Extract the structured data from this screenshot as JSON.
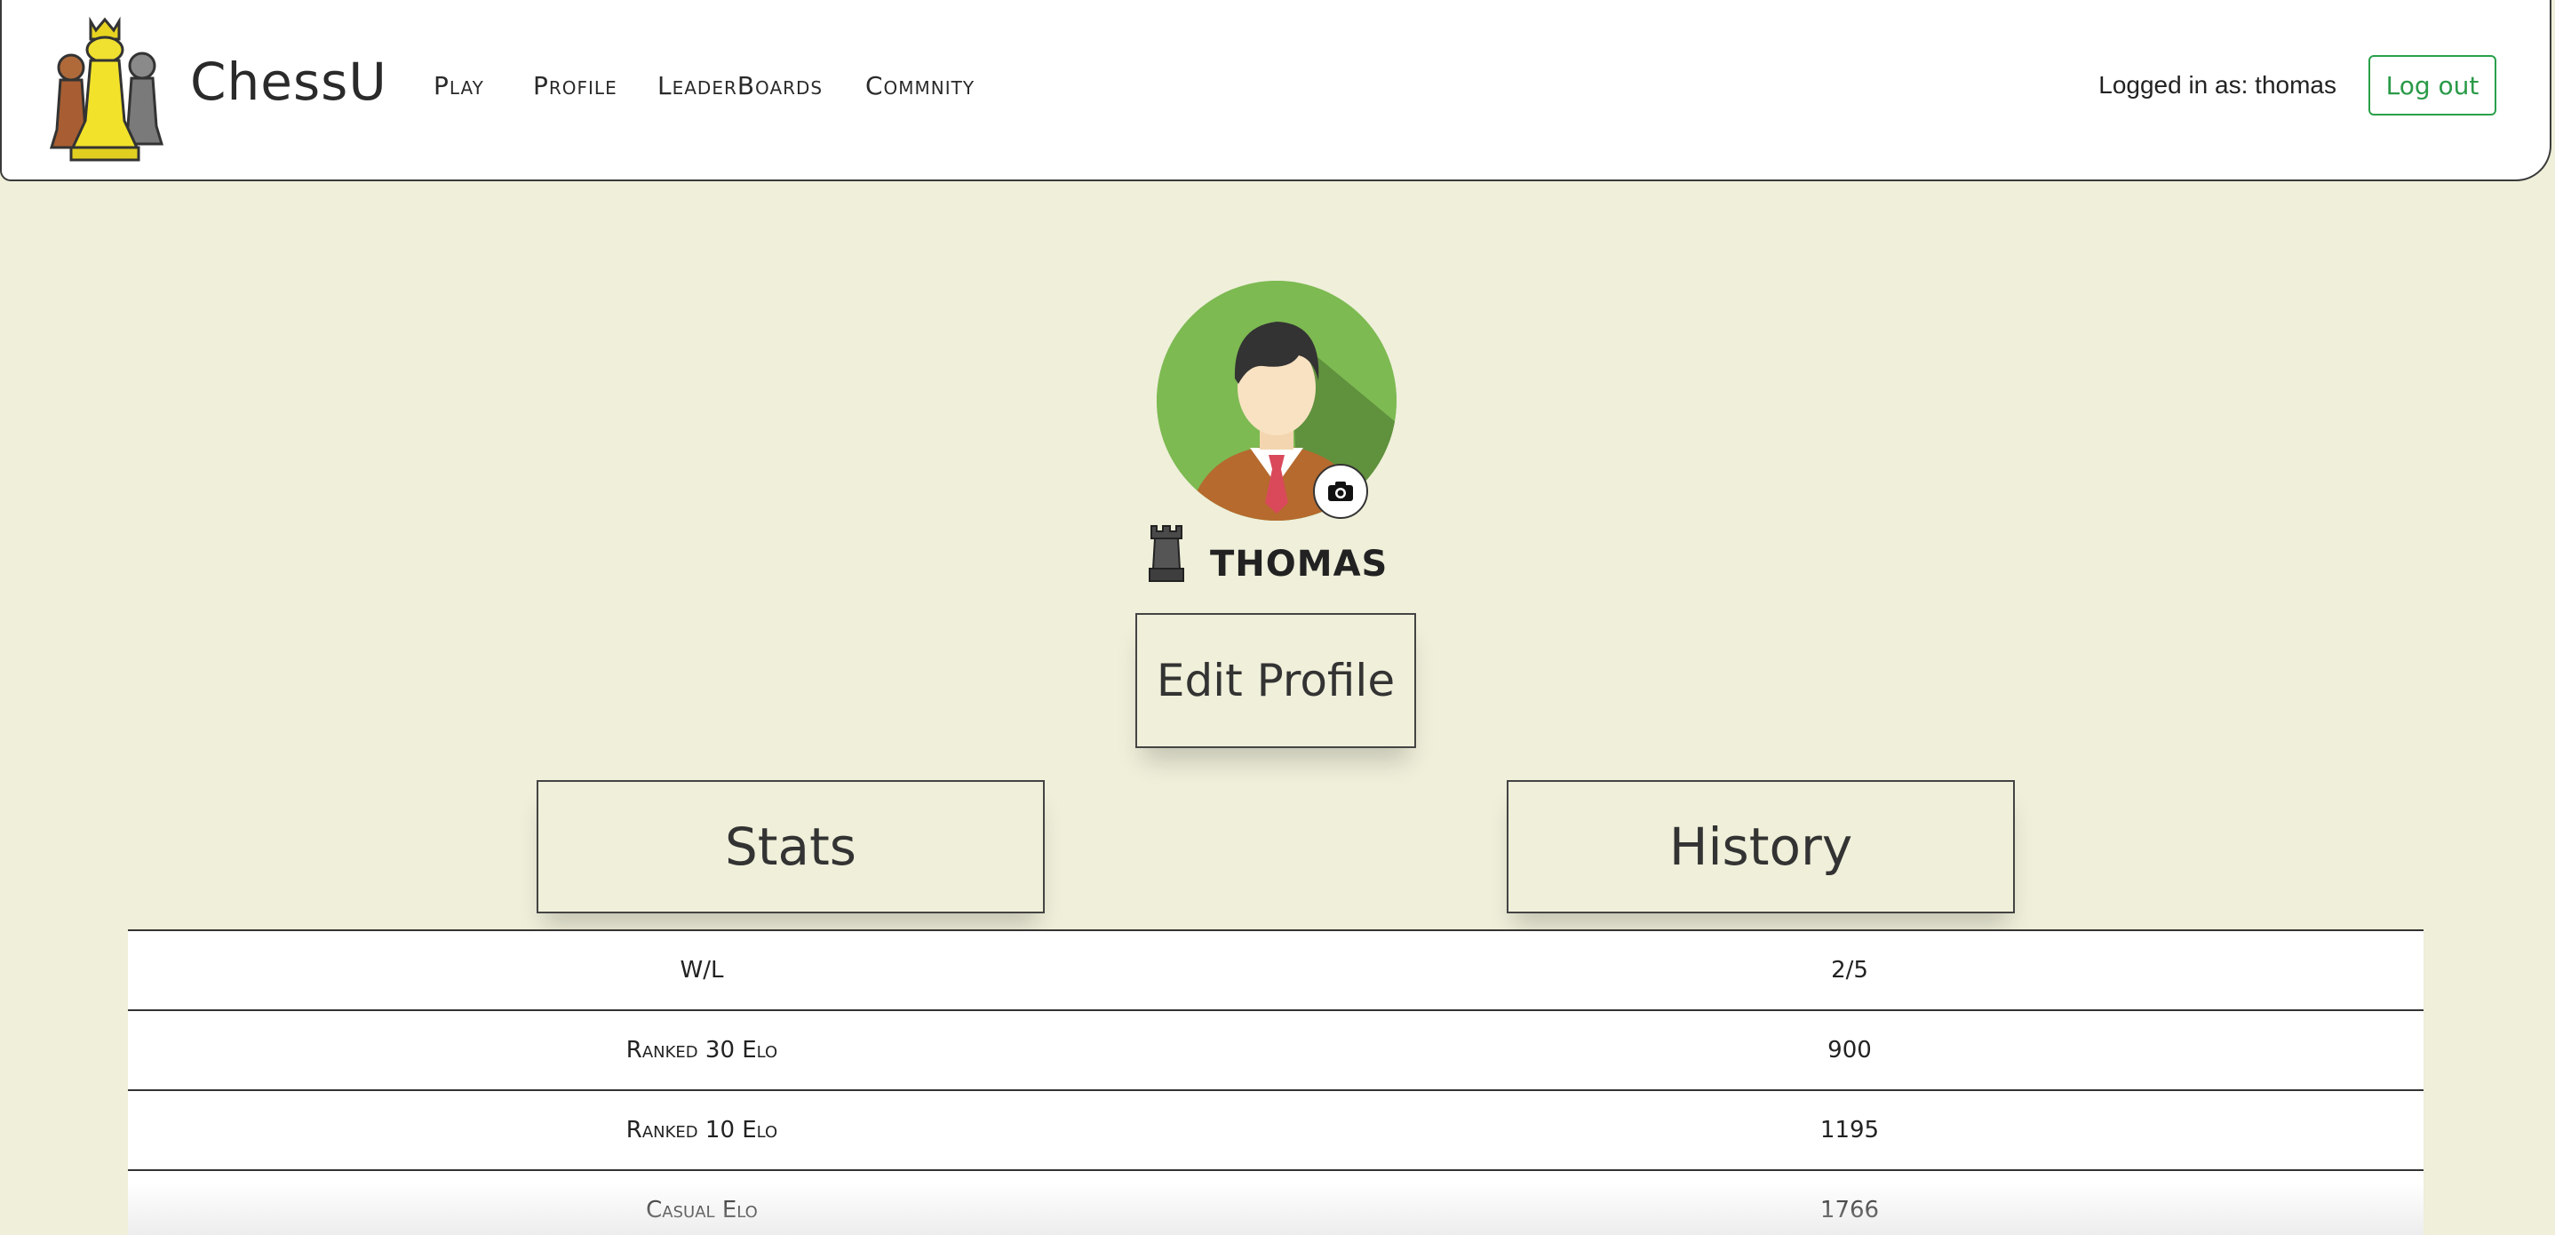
{
  "header": {
    "brand": "ChessU",
    "nav": [
      "Play",
      "Profile",
      "LeaderBoards",
      "Commnity"
    ],
    "logged_in_text": "Logged in as: thomas",
    "logout_label": "Log out"
  },
  "profile": {
    "username": "THOMAS",
    "edit_label": "Edit Profile"
  },
  "tabs": {
    "stats_label": "Stats",
    "history_label": "History"
  },
  "stats": [
    {
      "label": "W/L",
      "value": "2/5"
    },
    {
      "label": "Ranked 30 Elo",
      "value": "900"
    },
    {
      "label": "Ranked 10 Elo",
      "value": "1195"
    },
    {
      "label": "Casual Elo",
      "value": "1766"
    }
  ]
}
